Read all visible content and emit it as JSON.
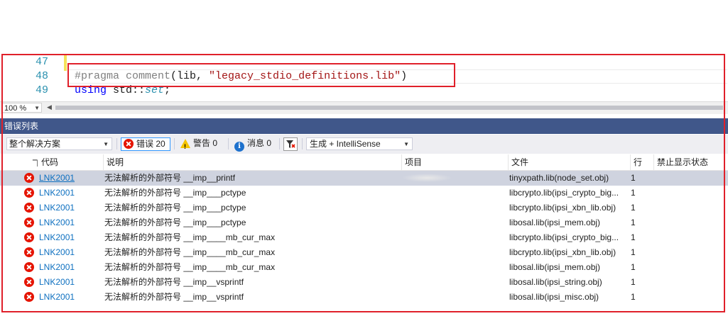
{
  "editor": {
    "lines": [
      {
        "number": "47",
        "code": ""
      },
      {
        "number": "48",
        "pragma": "#pragma comment",
        "open": "(lib, ",
        "string": "\"legacy_stdio_definitions.lib\"",
        "close": ")"
      },
      {
        "number": "49",
        "kw": "using",
        "ns": " std::",
        "type": "set",
        "end": ";"
      }
    ]
  },
  "zoom": {
    "value": "100 %"
  },
  "error_list": {
    "title": "错误列表",
    "scope": "整个解决方案",
    "errors_label": "错误 20",
    "warnings_label": "警告 0",
    "messages_label": "消息 0",
    "build_source": "生成 + IntelliSense",
    "columns": [
      "代码",
      "说明",
      "项目",
      "文件",
      "行",
      "禁止显示状态"
    ],
    "rows": [
      {
        "code": "LNK2001",
        "desc": "无法解析的外部符号 __imp__printf",
        "file": "tinyxpath.lib(node_set.obj)",
        "line": "1"
      },
      {
        "code": "LNK2001",
        "desc": "无法解析的外部符号 __imp___pctype",
        "file": "libcrypto.lib(ipsi_crypto_big...",
        "line": "1"
      },
      {
        "code": "LNK2001",
        "desc": "无法解析的外部符号 __imp___pctype",
        "file": "libcrypto.lib(ipsi_xbn_lib.obj)",
        "line": "1"
      },
      {
        "code": "LNK2001",
        "desc": "无法解析的外部符号 __imp___pctype",
        "file": "libosal.lib(ipsi_mem.obj)",
        "line": "1"
      },
      {
        "code": "LNK2001",
        "desc": "无法解析的外部符号 __imp____mb_cur_max",
        "file": "libcrypto.lib(ipsi_crypto_big...",
        "line": "1"
      },
      {
        "code": "LNK2001",
        "desc": "无法解析的外部符号 __imp____mb_cur_max",
        "file": "libcrypto.lib(ipsi_xbn_lib.obj)",
        "line": "1"
      },
      {
        "code": "LNK2001",
        "desc": "无法解析的外部符号 __imp____mb_cur_max",
        "file": "libosal.lib(ipsi_mem.obj)",
        "line": "1"
      },
      {
        "code": "LNK2001",
        "desc": "无法解析的外部符号 __imp__vsprintf",
        "file": "libosal.lib(ipsi_string.obj)",
        "line": "1"
      },
      {
        "code": "LNK2001",
        "desc": "无法解析的外部符号 __imp__vsprintf",
        "file": "libosal.lib(ipsi_misc.obj)",
        "line": "1"
      }
    ]
  },
  "colors": {
    "accent": "#40578a",
    "error": "#e51400",
    "link": "#0e70c0",
    "annotation": "#e0202a"
  }
}
